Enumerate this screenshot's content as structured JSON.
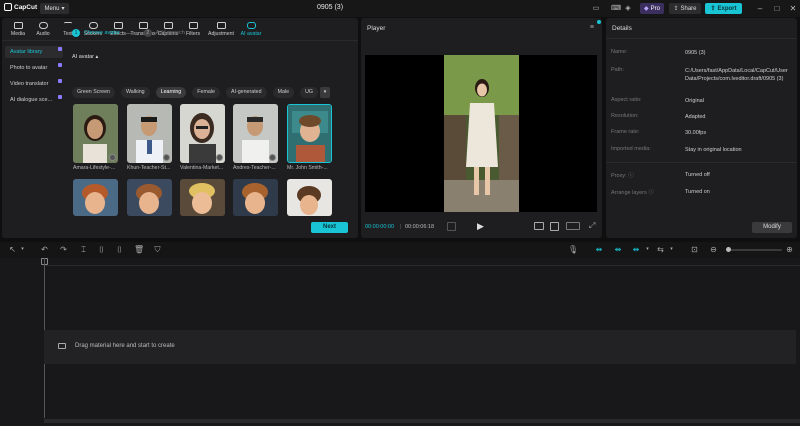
{
  "app": {
    "logo_text": "CapCut",
    "menu_label": "Menu",
    "project_title": "0905 (3)"
  },
  "header": {
    "pro_label": "Pro",
    "share_label": "Share",
    "export_label": "Export"
  },
  "toolbar": [
    {
      "label": "Media",
      "icon": "media-icon"
    },
    {
      "label": "Audio",
      "icon": "audio-icon"
    },
    {
      "label": "Text",
      "icon": "text-icon"
    },
    {
      "label": "Stickers",
      "icon": "stickers-icon"
    },
    {
      "label": "Effects",
      "icon": "effects-icon"
    },
    {
      "label": "Transitions",
      "icon": "transitions-icon"
    },
    {
      "label": "Captions",
      "icon": "captions-icon"
    },
    {
      "label": "Filters",
      "icon": "filters-icon"
    },
    {
      "label": "Adjustment",
      "icon": "adjustment-icon"
    },
    {
      "label": "AI avatar",
      "icon": "ai-avatar-icon",
      "active": true
    }
  ],
  "sidenav": [
    {
      "label": "Avatar library",
      "active": true
    },
    {
      "label": "Photo to avatar"
    },
    {
      "label": "Video translator"
    },
    {
      "label": "AI dialogue sce..."
    }
  ],
  "steps": {
    "step1_num": "1",
    "step1_label": "Choose avatar",
    "step2_num": "2",
    "step2_label": "Add speech"
  },
  "section": {
    "heading": "AI avatar"
  },
  "chips": [
    "Green Screen",
    "Walking",
    "Learning",
    "Female",
    "AI-generated",
    "Male",
    "UG"
  ],
  "active_chip": "Learning",
  "avatars": [
    {
      "name": "Amara-Lifestyle-..."
    },
    {
      "name": "Khun-Teacher-St..."
    },
    {
      "name": "Valentina-Market..."
    },
    {
      "name": "Andres-Teacher-..."
    },
    {
      "name": "Mr. John Smith-..."
    }
  ],
  "next_label": "Next",
  "player": {
    "title": "Player",
    "time_current": "00:00:00:00",
    "time_separator": "|",
    "time_total": "00:00:06:18"
  },
  "details": {
    "title": "Details",
    "rows": [
      {
        "label": "Name:",
        "value": "0905 (3)"
      },
      {
        "label": "Path:",
        "value": "C:/Users/fast/AppData/Local/CapCut/User Data/Projects/com.lveditor.draft/0905 (3)"
      },
      {
        "label": "Aspect ratio:",
        "value": "Original"
      },
      {
        "label": "Resolution:",
        "value": "Adapted"
      },
      {
        "label": "Frame rate:",
        "value": "30.00fps"
      },
      {
        "label": "Imported media:",
        "value": "Stay in original location"
      },
      {
        "label": "Proxy:",
        "value": "Turned off"
      },
      {
        "label": "Arrange layers",
        "value": "Turned on"
      }
    ],
    "modify_label": "Modify"
  },
  "timeline": {
    "drop_text": "Drag material here and start to create"
  },
  "colors": {
    "accent": "#19c4d4",
    "panel": "#1e1e20",
    "background": "#0f0f10",
    "pro": "#8a7bff"
  }
}
